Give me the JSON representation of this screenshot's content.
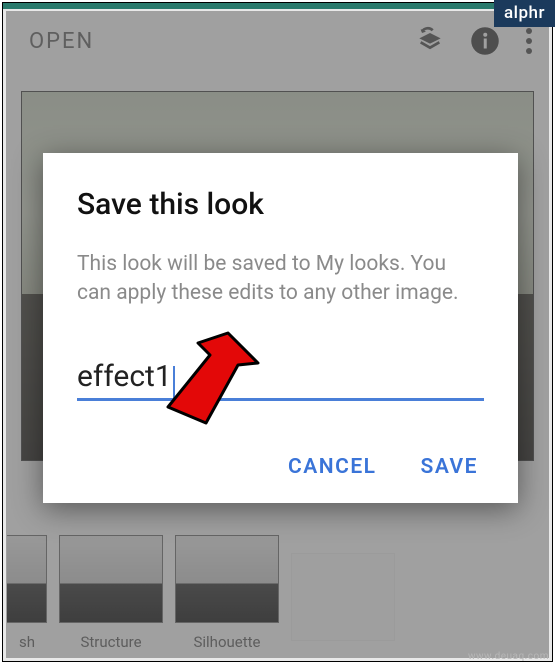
{
  "badge": "alphr",
  "watermark": "www.deuaq.com",
  "toolbar": {
    "open_label": "OPEN"
  },
  "thumbs": [
    {
      "label": "sh"
    },
    {
      "label": "Structure"
    },
    {
      "label": "Silhouette"
    },
    {
      "label": ""
    }
  ],
  "dialog": {
    "title": "Save this look",
    "body": "This look will be saved to My looks. You can apply these edits to any other image.",
    "input_value": "effect1",
    "cancel_label": "CANCEL",
    "save_label": "SAVE"
  }
}
